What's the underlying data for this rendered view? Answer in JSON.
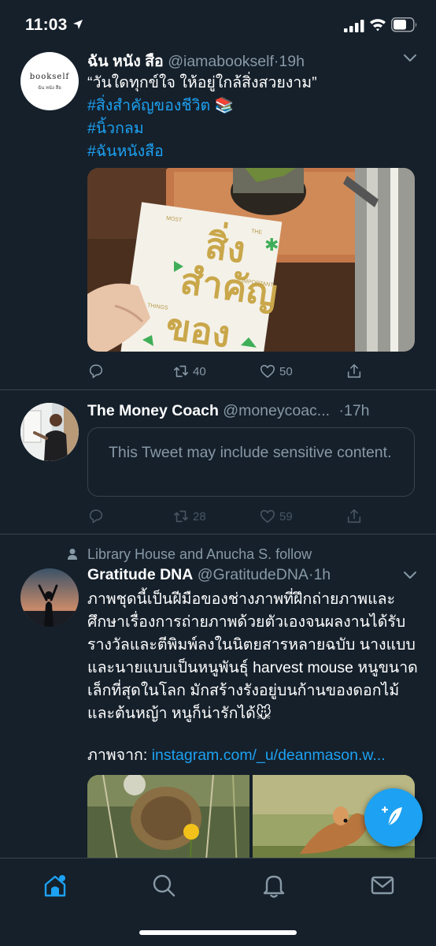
{
  "status": {
    "time": "11:03"
  },
  "tweets": [
    {
      "name": "ฉัน หนัง สือ",
      "handle": "@iamabookself",
      "time": "19h",
      "avatar_logo": "bookself",
      "avatar_sub": "ฉัน หนัง สือ",
      "text": "“วันใดทุกข์ใจ ให้อยู่ใกล้สิ่งสวยงาม”",
      "hashtags": [
        "#สิ่งสำคัญของชีวิต 📚",
        "#นิ้วกลม",
        "#ฉันหนังสือ"
      ],
      "book_title_1": "สิ่ง",
      "book_title_2": "สำคัญ",
      "book_title_3": "ของ",
      "book_small_left": "MOST",
      "book_small_right": "THE",
      "book_small_mid": "IMPORTANT",
      "book_small_things": "THINGS",
      "retweets": "40",
      "likes": "50"
    },
    {
      "name": "The Money Coach",
      "handle": "@moneycoac...",
      "time": "17h",
      "sensitive_text": "This Tweet may include sensitive content.",
      "retweets": "28",
      "likes": "59"
    },
    {
      "social_context": "Library House and Anucha S. follow",
      "name": "Gratitude DNA",
      "handle": "@GratitudeDNA",
      "time": "1h",
      "text": "ภาพชุดนี้เป็นฝีมือของช่างภาพที่ฝึกถ่ายภาพและศึกษาเรื่องการถ่ายภาพด้วยตัวเองจนผลงานได้รับรางวัลและตีพิมพ์ลงในนิตยสารหลายฉบับ นางแบบและนายแบบเป็นหนูพันธุ์ harvest mouse หนูขนาดเล็กที่สุดในโลก มักสร้างรังอยู่บนก้านของดอกไม้และต้นหญ้า หนูก็น่ารักได้🐭",
      "source_label": "ภาพจาก:",
      "source_link": "instagram.com/_u/deanmason.w..."
    }
  ],
  "colors": {
    "background": "#15202b",
    "accent": "#1da1f2",
    "muted": "#8899a6",
    "border": "#38444d"
  },
  "tabs": [
    "home-icon",
    "search-icon",
    "notifications-icon",
    "messages-icon"
  ]
}
